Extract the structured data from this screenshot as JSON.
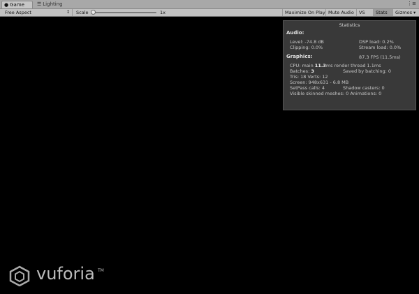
{
  "tabs": [
    {
      "label": "Game",
      "icon": "game-tab-icon"
    },
    {
      "label": "Lighting",
      "icon": "lighting-tab-icon"
    }
  ],
  "toolbar": {
    "aspect": "Free Aspect",
    "scale_label": "Scale",
    "scale_value": "1x",
    "maximize_on_play": "Maximize On Play",
    "mute_audio": "Mute Audio",
    "vs": "VS",
    "stats": "Stats",
    "gizmos": "Gizmos"
  },
  "stats_panel": {
    "title": "Statistics",
    "audio_header": "Audio:",
    "level": "Level: -74.8 dB",
    "dsp_load": "DSP load: 0.2%",
    "clipping": "Clipping: 0.0%",
    "stream_load": "Stream load: 0.0%",
    "graphics_header": "Graphics:",
    "fps": "87.3 FPS (11.5ms)",
    "cpu_prefix": "CPU: main",
    "cpu_main": "11.3",
    "cpu_suffix": "ms  render thread 1.1ms",
    "batches_prefix": "Batches:",
    "batches": "3",
    "saved_by_batching": "Saved by batching: 0",
    "tris": "Tris: 18   Verts: 12",
    "screen": "Screen: 948x631 - 6.8 MB",
    "setpass": "SetPass calls: 4",
    "shadow_casters": "Shadow casters: 0",
    "skinned_meshes": "Visible skinned meshes: 0  Animations: 0"
  },
  "logo": {
    "text": "vuforia",
    "tm": "TM"
  },
  "colors": {
    "tabbar": "#a8a8a8",
    "toolbar": "#c2c2c2",
    "viewport": "#000000",
    "stats_bg": "#3e3e3e",
    "stats_text": "#c8c8c8"
  }
}
